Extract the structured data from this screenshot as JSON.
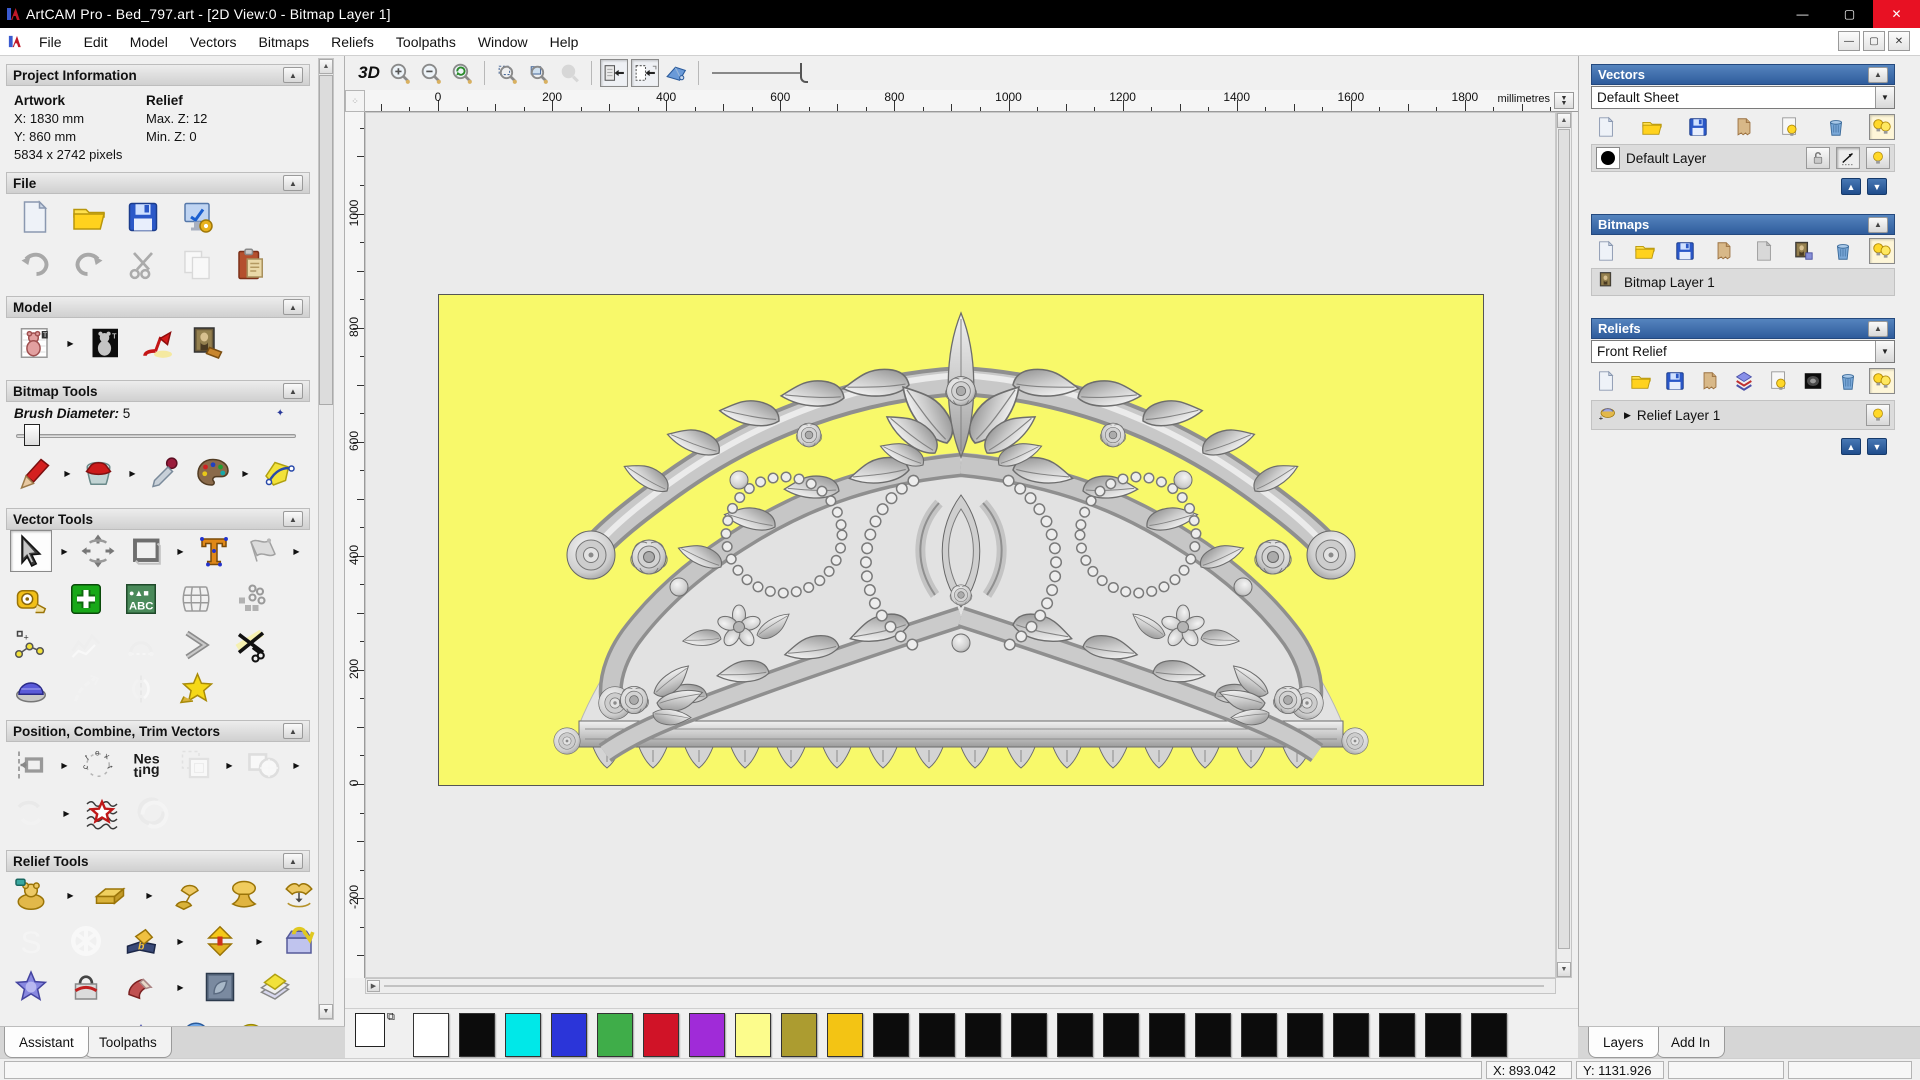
{
  "window": {
    "title": "ArtCAM Pro - Bed_797.art - [2D View:0 - Bitmap Layer 1]"
  },
  "menu": {
    "items": [
      "File",
      "Edit",
      "Model",
      "Vectors",
      "Bitmaps",
      "Reliefs",
      "Toolpaths",
      "Window",
      "Help"
    ]
  },
  "project_info": {
    "title": "Project Information",
    "artwork_label": "Artwork",
    "relief_label": "Relief",
    "x": "X: 1830 mm",
    "y": "Y: 860 mm",
    "pixels": "5834 x 2742 pixels",
    "max_z": "Max. Z: 12",
    "min_z": "Min. Z: 0"
  },
  "sections": {
    "file": {
      "title": "File",
      "rows": [
        [
          {
            "name": "new-model-button",
            "icon": "new"
          },
          {
            "name": "open-model-button",
            "icon": "folder"
          },
          {
            "name": "save-model-button",
            "icon": "floppy"
          },
          {
            "name": "model-properties-button",
            "icon": "props"
          }
        ],
        [
          {
            "name": "undo-button",
            "icon": "undo"
          },
          {
            "name": "redo-button",
            "icon": "redo"
          },
          {
            "name": "cut-button",
            "icon": "cut"
          },
          {
            "name": "copy-button",
            "icon": "copy",
            "gray": true
          },
          {
            "name": "paste-button",
            "icon": "paste"
          }
        ]
      ]
    },
    "model": {
      "title": "Model",
      "rows": [
        [
          {
            "name": "set-model-size-button",
            "icon": "teddy",
            "fly": true
          },
          {
            "name": "invert-model-button",
            "icon": "invert"
          },
          {
            "name": "lighting-button",
            "icon": "lamp"
          },
          {
            "name": "texture-relief-button",
            "icon": "mona"
          }
        ]
      ]
    },
    "bitmap": {
      "title": "Bitmap Tools",
      "brush_label": "Brush Diameter:",
      "brush_value": "5",
      "rows": [
        [
          {
            "name": "paint-tool",
            "icon": "brush",
            "fly": true
          },
          {
            "name": "flood-fill-tool",
            "icon": "bucket",
            "fly": true
          },
          {
            "name": "pick-colour-tool",
            "icon": "dropper"
          },
          {
            "name": "colour-palette-tool",
            "icon": "palette",
            "fly": true
          },
          {
            "name": "bitmap-to-vector-tool",
            "icon": "magic"
          }
        ]
      ]
    },
    "vector": {
      "title": "Vector Tools",
      "rows": [
        [
          {
            "name": "select-vectors-tool",
            "icon": "select",
            "pressed": true,
            "fly": true
          },
          {
            "name": "transform-vectors-tool",
            "icon": "transform"
          },
          {
            "name": "create-rectangle-tool",
            "icon": "recttool",
            "fly": true
          },
          {
            "name": "create-text-tool",
            "icon": "textT"
          },
          {
            "name": "envelope-distortion-tool",
            "icon": "envelope",
            "fly": true
          }
        ],
        [
          {
            "name": "measure-tool",
            "icon": "measure"
          },
          {
            "name": "create-vector-boundary-tool",
            "icon": "gplus"
          },
          {
            "name": "text-block-tool",
            "icon": "abc"
          },
          {
            "name": "distort-grid-tool",
            "icon": "cage"
          },
          {
            "name": "paste-along-curve-tool",
            "icon": "nodes"
          }
        ],
        [
          {
            "name": "create-polyline-tool",
            "icon": "polyline"
          },
          {
            "name": "freehand-polyline-tool",
            "icon": "zigzag",
            "gray": true
          },
          {
            "name": "create-arc-tool",
            "icon": "arcg",
            "gray": true
          },
          {
            "name": "fillet-tool",
            "icon": "chevron"
          },
          {
            "name": "trim-vectors-tool",
            "icon": "trim"
          }
        ],
        [
          {
            "name": "offset-vectors-tool",
            "icon": "dome"
          },
          {
            "name": "fit-curve-tool",
            "icon": "curveg",
            "gray": true
          },
          {
            "name": "mirror-vectors-tool",
            "icon": "mirrorc",
            "gray": true
          },
          {
            "name": "create-star-tool",
            "icon": "star"
          }
        ]
      ]
    },
    "position": {
      "title": "Position, Combine, Trim Vectors",
      "rows": [
        [
          {
            "name": "align-vectors-tool",
            "icon": "align",
            "fly": true
          },
          {
            "name": "text-on-curve-tool",
            "icon": "textcircle"
          },
          {
            "name": "nesting-tool",
            "icon": "nesting"
          },
          {
            "name": "block-copy-tool",
            "icon": "block",
            "fly": true,
            "gray": true
          },
          {
            "name": "weld-vectors-tool",
            "icon": "weld",
            "fly": true,
            "gray": true
          }
        ],
        [
          {
            "name": "join-vectors-tool",
            "icon": "joinv",
            "fly": true,
            "gray": true
          },
          {
            "name": "texture-flow-tool",
            "icon": "texstar"
          },
          {
            "name": "interlock-vectors-tool",
            "icon": "spiral",
            "gray": true
          }
        ]
      ]
    },
    "relief": {
      "title": "Relief Tools",
      "rows": [
        [
          {
            "name": "calculate-relief-tool",
            "icon": "gteddy",
            "fly": true
          },
          {
            "name": "zero-relief-tool",
            "icon": "gbar",
            "fly": true
          },
          {
            "name": "smooth-relief-tool",
            "icon": "gspin"
          },
          {
            "name": "sculpt-relief-tool",
            "icon": "gmush"
          },
          {
            "name": "offset-relief-tool",
            "icon": "ghands"
          }
        ],
        [
          {
            "name": "sculpting-tool",
            "icon": "sgray",
            "gray": true
          },
          {
            "name": "weave-wizard-tool",
            "icon": "knot",
            "gray": true
          },
          {
            "name": "relief-from-image-tool",
            "icon": "book",
            "fly": true
          },
          {
            "name": "shape-editor-tool",
            "icon": "diamond",
            "fly": true
          },
          {
            "name": "load-relief-tool",
            "icon": "purplebox"
          }
        ],
        [
          {
            "name": "create-shape-tool",
            "icon": "bstar"
          },
          {
            "name": "wrap-relief-tool",
            "icon": "bag"
          },
          {
            "name": "bend-relief-tool",
            "icon": "wedge",
            "fly": true
          },
          {
            "name": "face-wizard-tool",
            "icon": "emboss"
          },
          {
            "name": "relief-layers-tool",
            "icon": "papers"
          }
        ],
        [
          {
            "name": "dome-relief-tool",
            "icon": "redhat"
          },
          {
            "name": "weave-relief-tool",
            "icon": "basket"
          },
          {
            "name": "pyramid-relief-tool",
            "icon": "pyramid"
          },
          {
            "name": "sphere-relief-tool",
            "icon": "ball"
          },
          {
            "name": "fan-relief-tool",
            "icon": "fan"
          }
        ]
      ]
    }
  },
  "toolbar": {
    "view3d_label": "3D",
    "items": [
      {
        "name": "zoom-in-button",
        "icon": "magplus"
      },
      {
        "name": "zoom-out-button",
        "icon": "magminus"
      },
      {
        "name": "zoom-previous-button",
        "icon": "magprev"
      },
      {
        "sep": true
      },
      {
        "name": "zoom-box-button",
        "icon": "magbox"
      },
      {
        "name": "zoom-fit-button",
        "icon": "magfit"
      },
      {
        "name": "zoom-object-button",
        "icon": "maggray",
        "gray": true
      },
      {
        "sep": true
      },
      {
        "name": "toggle-bitmap-visibility-button",
        "icon": "tglA",
        "pressed": true
      },
      {
        "name": "toggle-vector-visibility-button",
        "icon": "tglB",
        "pressed": true
      },
      {
        "name": "preview-relief-button",
        "icon": "previewB"
      },
      {
        "sep": true
      }
    ]
  },
  "ruler": {
    "unit": "millimetres",
    "h_labels": [
      0,
      200,
      400,
      600,
      800,
      1000,
      1200,
      1400,
      1600,
      1800
    ],
    "v_labels": [
      1000,
      800,
      600,
      400,
      200,
      0,
      -200
    ]
  },
  "canvas": {
    "bg": "#F8F96A"
  },
  "right_panel": {
    "vectors": {
      "title": "Vectors",
      "sheet": "Default Sheet",
      "layer": "Default Layer",
      "icons": [
        {
          "name": "new-vector-layer-button",
          "icon": "new"
        },
        {
          "name": "open-vector-layer-button",
          "icon": "folder"
        },
        {
          "name": "save-vector-layer-button",
          "icon": "floppy"
        },
        {
          "name": "merge-vector-layers-button",
          "icon": "merge"
        },
        {
          "name": "toggle-layer-visibility-button",
          "icon": "bulbpage"
        },
        {
          "name": "delete-vector-layer-button",
          "icon": "trash"
        },
        {
          "name": "toggle-all-layers-button",
          "icon": "bulbs",
          "pressed": true
        }
      ]
    },
    "bitmaps": {
      "title": "Bitmaps",
      "layer": "Bitmap Layer 1",
      "icons": [
        {
          "name": "new-bitmap-layer-button",
          "icon": "new"
        },
        {
          "name": "open-bitmap-layer-button",
          "icon": "folder"
        },
        {
          "name": "save-bitmap-layer-button",
          "icon": "floppy"
        },
        {
          "name": "merge-bitmap-layers-button",
          "icon": "merge"
        },
        {
          "name": "clear-bitmap-layer-button",
          "icon": "graypage"
        },
        {
          "name": "bitmap-preview-button",
          "icon": "monasm"
        },
        {
          "name": "delete-bitmap-layer-button",
          "icon": "trash"
        },
        {
          "name": "toggle-all-bitmaps-button",
          "icon": "bulbs",
          "pressed": true
        }
      ]
    },
    "reliefs": {
      "title": "Reliefs",
      "combo": "Front Relief",
      "layer": "Relief Layer 1",
      "icons": [
        {
          "name": "new-relief-layer-button",
          "icon": "new"
        },
        {
          "name": "open-relief-layer-button",
          "icon": "folder"
        },
        {
          "name": "save-relief-layer-button",
          "icon": "floppy"
        },
        {
          "name": "merge-relief-layers-button",
          "icon": "merge"
        },
        {
          "name": "stack-relief-layers-button",
          "icon": "stack"
        },
        {
          "name": "relief-visibility-button",
          "icon": "bulbpage"
        },
        {
          "name": "relief-greyscale-button",
          "icon": "darkimg"
        },
        {
          "name": "delete-relief-layer-button",
          "icon": "trash"
        },
        {
          "name": "toggle-all-reliefs-button",
          "icon": "bulbs",
          "pressed": true
        }
      ]
    },
    "tabs": {
      "layers": "Layers",
      "addin": "Add In"
    }
  },
  "left_tabs": {
    "assistant": "Assistant",
    "toolpaths": "Toolpaths"
  },
  "palette": {
    "primary": "#FFFFFF",
    "secondary": "#000000",
    "swatches": [
      "#FFFFFF",
      "#0C0C0C",
      "#00E8E8",
      "#2B35D9",
      "#3FAD49",
      "#D01327",
      "#A02BD8",
      "#FCFC8C",
      "#AC9C30",
      "#F3C414",
      "#0C0C0C",
      "#0C0C0C",
      "#0C0C0C",
      "#0C0C0C",
      "#0C0C0C",
      "#0C0C0C",
      "#0C0C0C",
      "#0C0C0C",
      "#0C0C0C",
      "#0C0C0C",
      "#0C0C0C",
      "#0C0C0C",
      "#0C0C0C",
      "#0C0C0C"
    ]
  },
  "status": {
    "x": "X: 893.042",
    "y": "Y: 1131.926"
  }
}
